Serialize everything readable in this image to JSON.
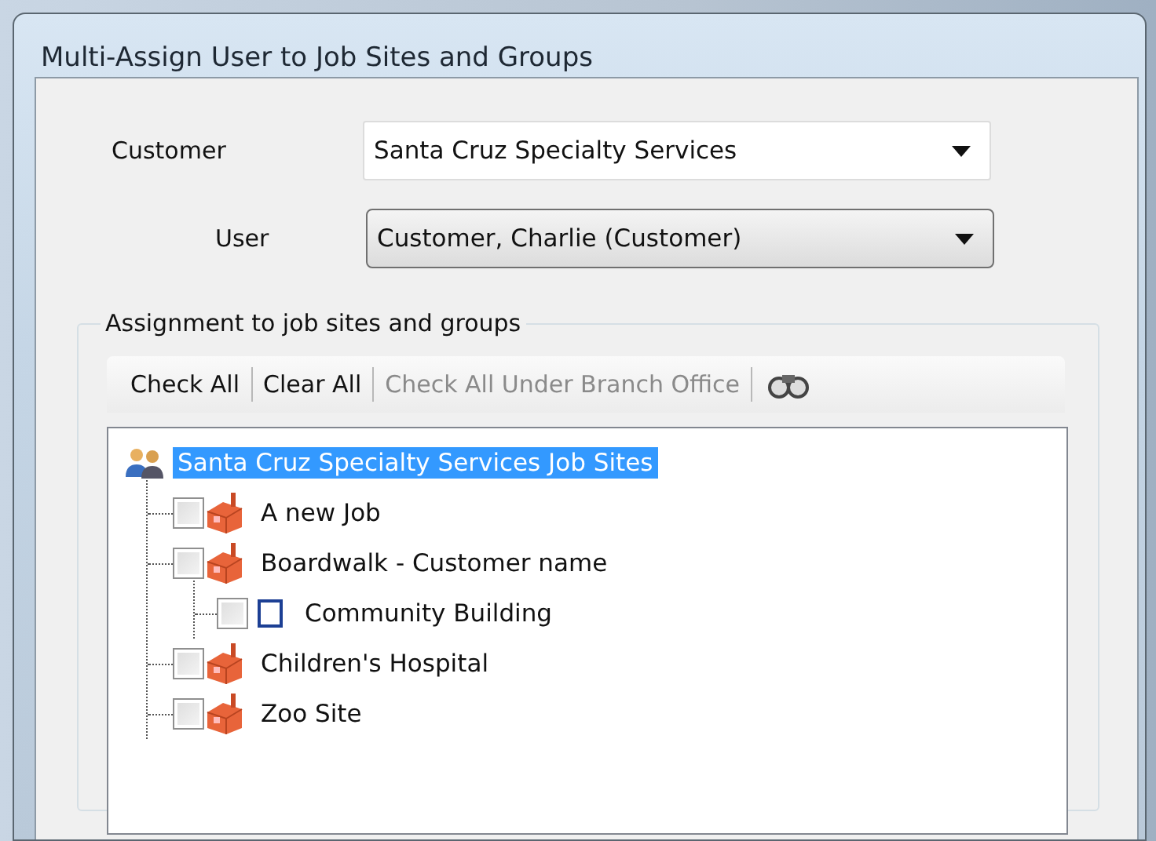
{
  "window": {
    "title": "Multi-Assign User to Job Sites and Groups"
  },
  "customer": {
    "label": "Customer",
    "value": "Santa Cruz Specialty Services"
  },
  "user": {
    "label": "User",
    "value": "Customer, Charlie (Customer)"
  },
  "assignment": {
    "legend": "Assignment to job sites and groups",
    "toolbar": [
      {
        "kind": "text",
        "label": "Check All",
        "disabled": false
      },
      {
        "kind": "text",
        "label": "Clear All",
        "disabled": false
      },
      {
        "kind": "text",
        "label": "Check All Under Branch Office",
        "disabled": true
      },
      {
        "kind": "find"
      }
    ],
    "tree": [
      {
        "kind": "root",
        "label": "Santa Cruz Specialty Services Job Sites",
        "selected": true,
        "children": [
          {
            "kind": "site",
            "label": "A new Job",
            "checked": false,
            "selected": false
          },
          {
            "kind": "site",
            "label": "Boardwalk - Customer name",
            "checked": false,
            "selected": false,
            "children": [
              {
                "kind": "group",
                "label": "Community Building",
                "checked": false,
                "selected": false
              }
            ]
          },
          {
            "kind": "site",
            "label": "Children's Hospital",
            "checked": false,
            "selected": false
          },
          {
            "kind": "site",
            "label": "Zoo Site",
            "checked": false,
            "selected": false
          }
        ]
      }
    ]
  }
}
